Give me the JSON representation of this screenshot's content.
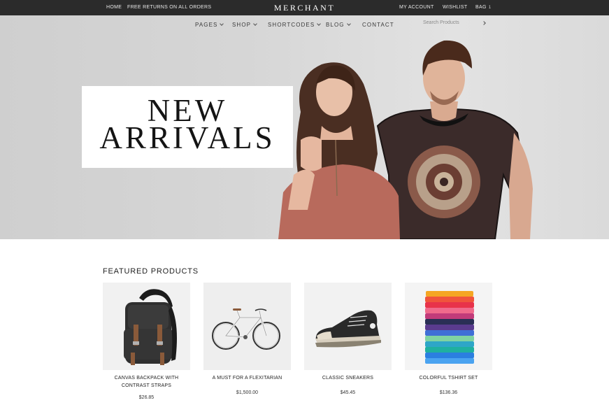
{
  "topbar": {
    "home": "HOME",
    "promo": "FREE RETURNS ON ALL ORDERS",
    "brand": "MERCHANT",
    "account": "MY ACCOUNT",
    "wishlist": "WISHLIST",
    "bag": "BAG",
    "bag_count": "1"
  },
  "nav": {
    "items": [
      "PAGES",
      "SHOP",
      "SHORTCODES",
      "BLOG",
      "CONTACT"
    ],
    "search_placeholder": "Search Products"
  },
  "hero": {
    "line1": "NEW",
    "line2": "ARRIVALS"
  },
  "featured": {
    "title": "FEATURED PRODUCTS",
    "products": [
      {
        "name": "CANVAS BACKPACK WITH CONTRAST STRAPS",
        "price": "$26.85",
        "icon": "backpack-image"
      },
      {
        "name": "A MUST FOR A FLEXITARIAN",
        "price": "$1,500.00",
        "icon": "bicycle-image"
      },
      {
        "name": "CLASSIC SNEAKERS",
        "price": "$45.45",
        "icon": "sneaker-image"
      },
      {
        "name": "COLORFUL TSHIRT SET",
        "price": "$136.36",
        "icon": "tshirt-stack-image"
      }
    ]
  },
  "colors": {
    "topbar_bg": "#2b2b2b",
    "hero_bg": "#d6d6d6",
    "text_dark": "#1f1f1f"
  }
}
